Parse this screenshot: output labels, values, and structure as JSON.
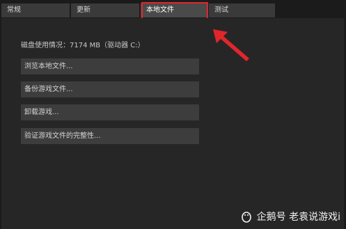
{
  "tabs": [
    {
      "label": "常规"
    },
    {
      "label": "更新"
    },
    {
      "label": "本地文件"
    },
    {
      "label": "测试"
    }
  ],
  "active_tab": "本地文件",
  "disk_usage": "磁盘使用情况：7174 MB（驱动器 C:）",
  "buttons": {
    "browse": "浏览本地文件...",
    "backup": "备份游戏文件...",
    "uninstall": "卸载游戏...",
    "verify": "验证游戏文件的完整性..."
  },
  "watermark": {
    "text": "企鹅号 老袁说游戏i",
    "icon": "penguin-logo-icon"
  },
  "colors": {
    "annotation_red": "#e0262b",
    "background": "#262627",
    "button": "#3d3d3e",
    "tab": "#3a3a3b"
  }
}
